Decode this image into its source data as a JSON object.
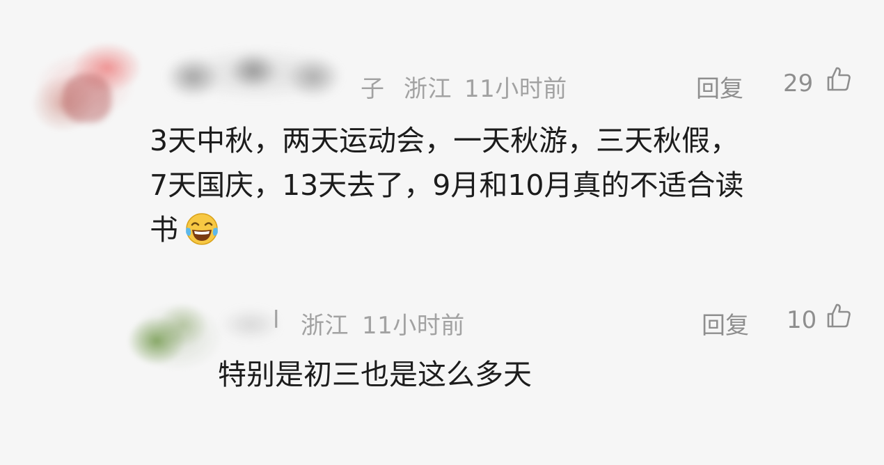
{
  "comments": [
    {
      "username_tail": "子",
      "location": "浙江",
      "time": "11小时前",
      "reply_label": "回复",
      "likes": "29",
      "body_lines": [
        "3天中秋，两天运动会，一天秋游，三天秋假，",
        "7天国庆，13天去了，9月和10月真的不适合读",
        "书"
      ],
      "emoji": "laughing-with-tears"
    },
    {
      "username_tail": "l",
      "location": "浙江",
      "time": "11小时前",
      "reply_label": "回复",
      "likes": "10",
      "body_lines": [
        "特别是初三也是这么多天"
      ]
    }
  ],
  "colors": {
    "background": "#f6f6f6",
    "body_text": "#1c1c1c",
    "meta_text": "#a2a2a2",
    "action_text": "#8e8e8e"
  }
}
